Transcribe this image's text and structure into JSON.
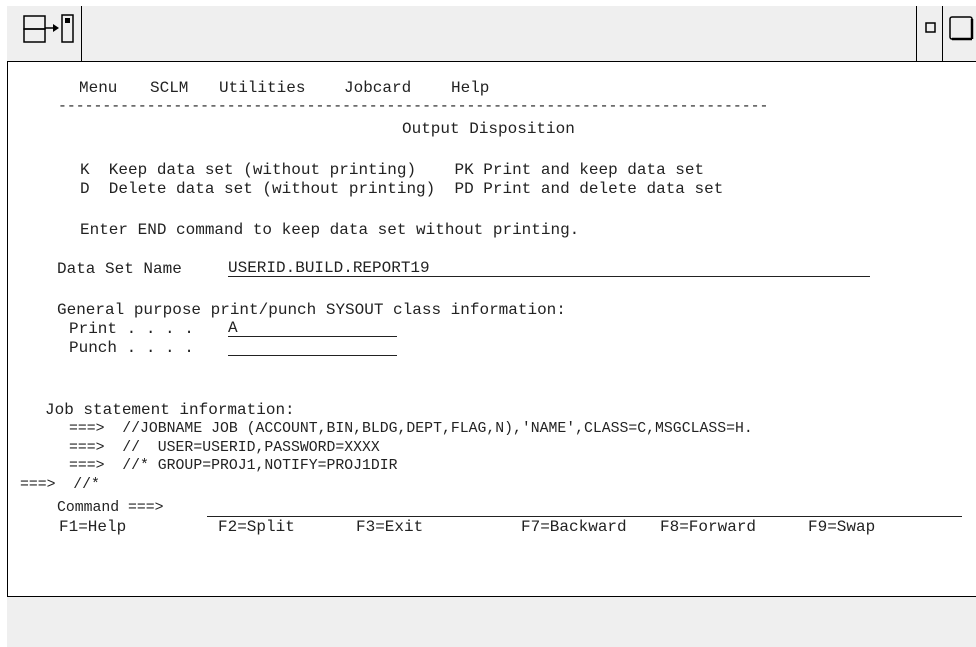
{
  "menubar": {
    "items": [
      "Menu",
      "SCLM",
      "Utilities",
      "Jobcard",
      "Help"
    ]
  },
  "separator": "--------------------------------------------------------------------------------",
  "panel": {
    "title": "Output Disposition",
    "options": [
      "K  Keep data set (without printing)    PK Print and keep data set",
      "D  Delete data set (without printing)  PD Print and delete data set"
    ],
    "instruction": "Enter END command to keep data set without printing."
  },
  "data_set": {
    "label": "Data Set Name",
    "value": "USERID.BUILD.REPORT19"
  },
  "sysout": {
    "heading": "General purpose print/punch SYSOUT class information:",
    "print_label": "Print . . . .",
    "print_value": "A",
    "punch_label": "Punch . . . .",
    "punch_value": ""
  },
  "job": {
    "heading": "Job statement information:",
    "lines": [
      "===>  //JOBNAME JOB (ACCOUNT,BIN,BLDG,DEPT,FLAG,N),'NAME',CLASS=C,MSGCLASS=H.",
      "===>  //  USER=USERID,PASSWORD=XXXX",
      "===>  //* GROUP=PROJ1,NOTIFY=PROJ1DIR",
      "===>  //*"
    ]
  },
  "command": {
    "label": "Command ===>",
    "value": ""
  },
  "function_keys": [
    "F1=Help",
    "F2=Split",
    "F3=Exit",
    "F7=Backward",
    "F8=Forward",
    "F9=Swap"
  ],
  "window_controls": {
    "system_menu_icon": "system-menu-icon",
    "minimize_icon": "minimize-icon",
    "maximize_icon": "maximize-icon"
  }
}
